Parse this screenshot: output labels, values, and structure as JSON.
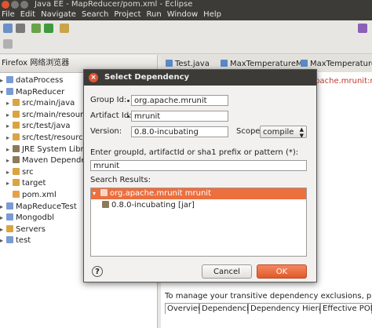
{
  "window": {
    "title": "Java EE - MapReducer/pom.xml - Eclipse"
  },
  "menu": [
    "File",
    "Edit",
    "Navigate",
    "Search",
    "Project",
    "Run",
    "Window",
    "Help"
  ],
  "left_panel": {
    "header": "Firefox 网络浏览器",
    "tree": [
      {
        "label": "dataProcess",
        "expanded": false,
        "indent": 0,
        "icon": "project-icon"
      },
      {
        "label": "MapReducer",
        "expanded": true,
        "indent": 0,
        "icon": "project-icon"
      },
      {
        "label": "src/main/java",
        "expanded": false,
        "indent": 1,
        "icon": "source-folder-icon"
      },
      {
        "label": "src/main/resources",
        "expanded": false,
        "indent": 1,
        "icon": "source-folder-icon"
      },
      {
        "label": "src/test/java",
        "expanded": false,
        "indent": 1,
        "icon": "source-folder-icon"
      },
      {
        "label": "src/test/resources",
        "expanded": false,
        "indent": 1,
        "icon": "source-folder-icon"
      },
      {
        "label": "JRE System Library",
        "expanded": false,
        "indent": 1,
        "icon": "library-icon"
      },
      {
        "label": "Maven Dependencies",
        "expanded": false,
        "indent": 1,
        "icon": "library-icon"
      },
      {
        "label": "src",
        "expanded": false,
        "indent": 1,
        "icon": "folder-icon"
      },
      {
        "label": "target",
        "expanded": false,
        "indent": 1,
        "icon": "folder-icon"
      },
      {
        "label": "pom.xml",
        "expanded": null,
        "indent": 1,
        "icon": "xml-file-icon"
      },
      {
        "label": "MapReduceTest",
        "expanded": false,
        "indent": 0,
        "icon": "project-icon"
      },
      {
        "label": "Mongodbl",
        "expanded": false,
        "indent": 0,
        "icon": "project-icon"
      },
      {
        "label": "Servers",
        "expanded": false,
        "indent": 0,
        "icon": "folder-icon"
      },
      {
        "label": "test",
        "expanded": false,
        "indent": 0,
        "icon": "project-icon"
      }
    ]
  },
  "editor_tabs": [
    "Test.java",
    "MaxTemperatureM",
    "MaxTemperatureR"
  ],
  "editor_snippet": "apache.mrunit:mru",
  "dialog": {
    "title": "Select Dependency",
    "group_id_label": "Group Id:",
    "group_id_value": "org.apache.mrunit",
    "artifact_id_label": "Artifact Id:",
    "artifact_id_value": "mrunit",
    "version_label": "Version:",
    "version_value": "0.8.0-incubating",
    "scope_label": "Scope:",
    "scope_value": "compile",
    "search_prompt": "Enter groupId, artifactId or sha1 prefix or pattern (*):",
    "search_value": "mrunit",
    "results_label": "Search Results:",
    "results": [
      {
        "label": "org.apache.mrunit  mrunit",
        "selected": true
      },
      {
        "label": "0.8.0-incubating [jar]",
        "selected": false
      }
    ],
    "help_label": "?",
    "cancel_label": "Cancel",
    "ok_label": "OK"
  },
  "bottom": {
    "info": "To manage your transitive dependency exclusions, please use the",
    "tabs": [
      "Overview",
      "Dependencies",
      "Dependency Hierarchy",
      "Effective POM"
    ]
  },
  "colors": {
    "accent": "#ec6f3e",
    "titlebar": "#3c3b37"
  }
}
